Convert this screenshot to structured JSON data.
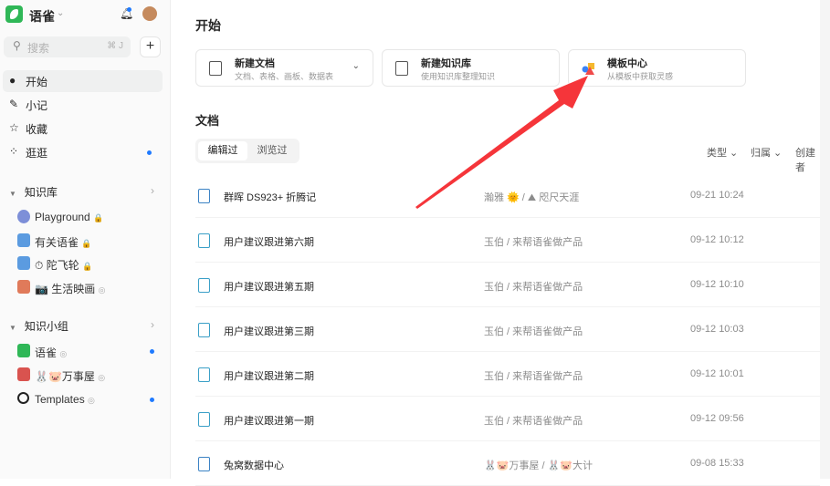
{
  "sidebar": {
    "brand": "语雀",
    "search_placeholder": "搜索",
    "search_shortcut": "⌘ J",
    "nav": [
      {
        "label": "开始",
        "icon": "clock-icon"
      },
      {
        "label": "小记",
        "icon": "feather-icon"
      },
      {
        "label": "收藏",
        "icon": "star-icon"
      },
      {
        "label": "逛逛",
        "icon": "grid-icon"
      }
    ],
    "kb_section": "知识库",
    "kb": [
      {
        "label": "Playground",
        "badge": "🔒"
      },
      {
        "label": "有关语雀",
        "badge": "🔒"
      },
      {
        "label": "⏱ 陀飞轮",
        "badge": "🔒"
      },
      {
        "label": "📷 生活映画",
        "badge": "◎"
      }
    ],
    "group_section": "知识小组",
    "groups": [
      {
        "label": "语雀",
        "badge": "◎"
      },
      {
        "label": "🐰🐷万事屋",
        "badge": "◎"
      },
      {
        "label": "Templates",
        "badge": "◎"
      }
    ]
  },
  "main": {
    "title": "开始",
    "cards": [
      {
        "title": "新建文档",
        "subtitle": "文档、表格、画板、数据表"
      },
      {
        "title": "新建知识库",
        "subtitle": "使用知识库整理知识"
      },
      {
        "title": "模板中心",
        "subtitle": "从模板中获取灵感"
      }
    ],
    "docs_title": "文档",
    "tabs": [
      "编辑过",
      "浏览过"
    ],
    "filters": [
      "类型 ⌄",
      "归属 ⌄",
      "创建者"
    ],
    "rows": [
      {
        "name": "群晖 DS923+ 折腾记",
        "where": "瀚雅 🌞 / ⛰ 咫尺天涯",
        "time": "09-21 10:24"
      },
      {
        "name": "用户建议跟进第六期",
        "where": "玉伯 / 来帮语雀做产品",
        "time": "09-12 10:12"
      },
      {
        "name": "用户建议跟进第五期",
        "where": "玉伯 / 来帮语雀做产品",
        "time": "09-12 10:10"
      },
      {
        "name": "用户建议跟进第三期",
        "where": "玉伯 / 来帮语雀做产品",
        "time": "09-12 10:03"
      },
      {
        "name": "用户建议跟进第二期",
        "where": "玉伯 / 来帮语雀做产品",
        "time": "09-12 10:01"
      },
      {
        "name": "用户建议跟进第一期",
        "where": "玉伯 / 来帮语雀做产品",
        "time": "09-12 09:56"
      },
      {
        "name": "兔窝数据中心",
        "where": "🐰🐷万事屋 / 🐰🐷大计",
        "time": "09-08 15:33"
      }
    ]
  },
  "colors": {
    "accent": "#1f7aff",
    "arrow": "#f5353a",
    "brand": "#2fb757"
  }
}
